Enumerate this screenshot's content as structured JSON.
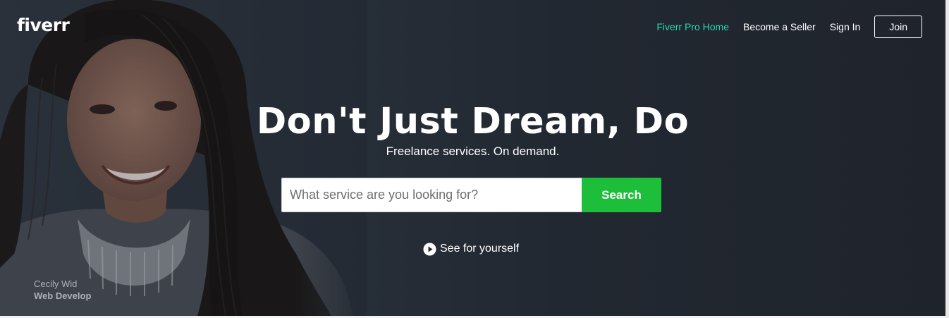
{
  "header": {
    "logo_text": "fiverr",
    "nav": {
      "pro_home": "Fiverr Pro Home",
      "become_seller": "Become a Seller",
      "sign_in": "Sign In",
      "join": "Join"
    }
  },
  "hero": {
    "headline": "Don't Just Dream, Do",
    "subhead": "Freelance services. On demand.",
    "search": {
      "placeholder": "What service are you looking for?",
      "value": "",
      "button_label": "Search"
    },
    "video_link": {
      "label": "See for yourself",
      "icon": "play-icon"
    },
    "caption": {
      "name": "Cecily Wid",
      "role": "Web Develop"
    }
  },
  "colors": {
    "accent_green": "#1dbf3a",
    "pro_link": "#2bd5b0",
    "hero_background": "#222831"
  }
}
